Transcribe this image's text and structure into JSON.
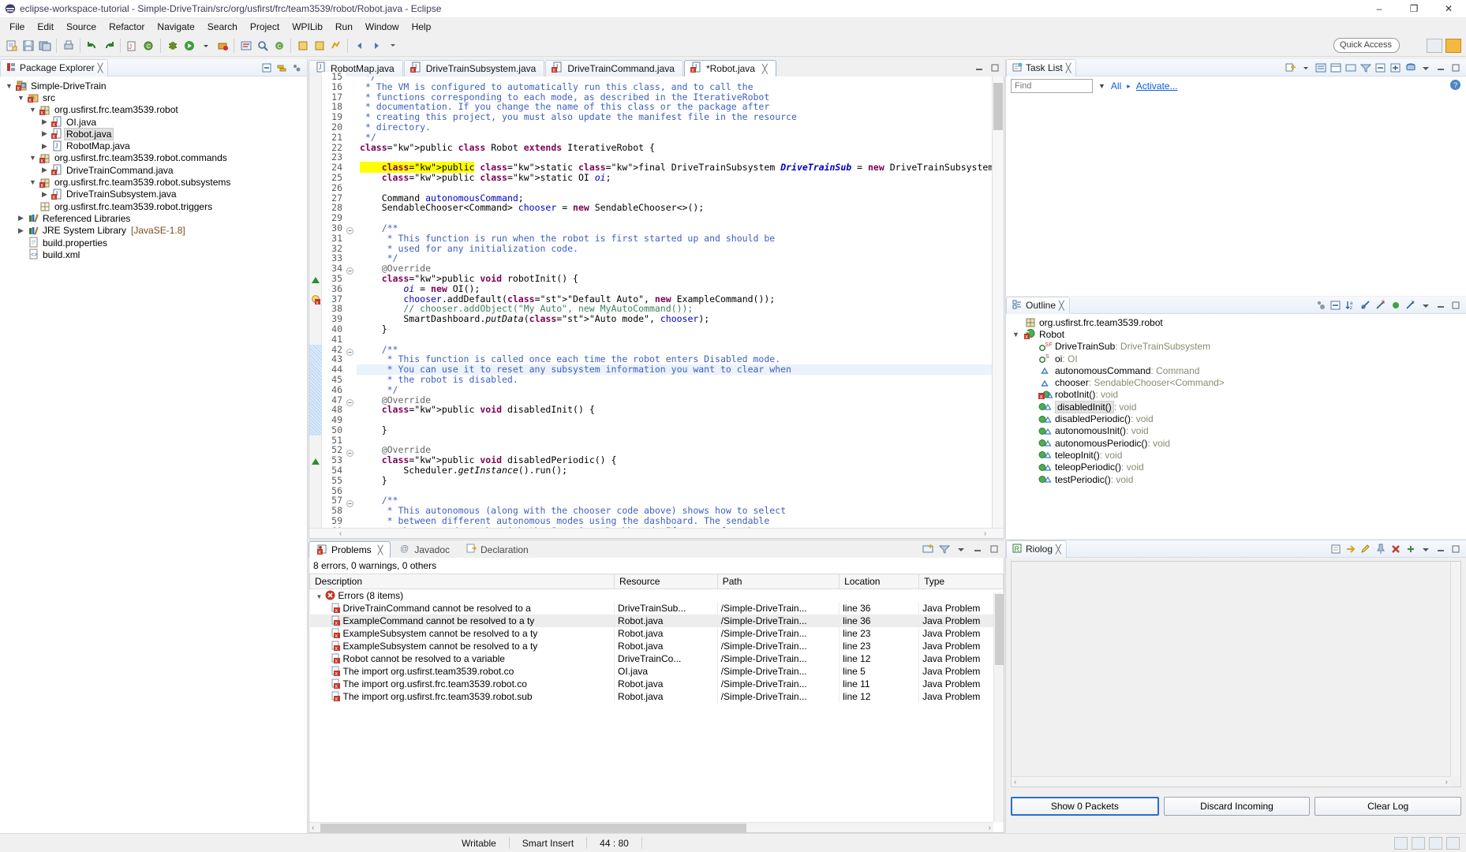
{
  "window": {
    "title": "eclipse-workspace-tutorial - Simple-DriveTrain/src/org/usfirst/frc/team3539/robot/Robot.java - Eclipse",
    "minimize": "–",
    "maximize": "❐",
    "close": "✕"
  },
  "menubar": {
    "items": [
      "File",
      "Edit",
      "Source",
      "Refactor",
      "Navigate",
      "Search",
      "Project",
      "WPILib",
      "Run",
      "Window",
      "Help"
    ]
  },
  "toolbar": {
    "quick_access_placeholder": "Quick Access"
  },
  "package_explorer": {
    "title": "Package Explorer",
    "tree": [
      {
        "label": "Simple-DriveTrain",
        "indent": 0,
        "twisty": "v",
        "icon": "project-error-icon",
        "selected": false
      },
      {
        "label": "src",
        "indent": 1,
        "twisty": "v",
        "icon": "source-folder-error-icon",
        "selected": false
      },
      {
        "label": "org.usfirst.frc.team3539.robot",
        "indent": 2,
        "twisty": "v",
        "icon": "package-error-icon",
        "selected": false
      },
      {
        "label": "OI.java",
        "indent": 3,
        "twisty": ">",
        "icon": "java-file-error-icon",
        "selected": false
      },
      {
        "label": "Robot.java",
        "indent": 3,
        "twisty": ">",
        "icon": "java-file-error-icon",
        "selected": true
      },
      {
        "label": "RobotMap.java",
        "indent": 3,
        "twisty": ">",
        "icon": "java-file-icon",
        "selected": false
      },
      {
        "label": "org.usfirst.frc.team3539.robot.commands",
        "indent": 2,
        "twisty": "v",
        "icon": "package-error-icon",
        "selected": false
      },
      {
        "label": "DriveTrainCommand.java",
        "indent": 3,
        "twisty": ">",
        "icon": "java-file-error-icon",
        "selected": false
      },
      {
        "label": "org.usfirst.frc.team3539.robot.subsystems",
        "indent": 2,
        "twisty": "v",
        "icon": "package-error-icon",
        "selected": false
      },
      {
        "label": "DriveTrainSubsystem.java",
        "indent": 3,
        "twisty": ">",
        "icon": "java-file-error-icon",
        "selected": false
      },
      {
        "label": "org.usfirst.frc.team3539.robot.triggers",
        "indent": 2,
        "twisty": "",
        "icon": "package-empty-icon",
        "selected": false
      },
      {
        "label": "Referenced Libraries",
        "indent": 1,
        "twisty": ">",
        "icon": "library-icon",
        "selected": false
      },
      {
        "label": "JRE System Library",
        "suffix": "[JavaSE-1.8]",
        "indent": 1,
        "twisty": ">",
        "icon": "library-icon",
        "selected": false
      },
      {
        "label": "build.properties",
        "indent": 1,
        "twisty": "",
        "icon": "file-icon",
        "selected": false
      },
      {
        "label": "build.xml",
        "indent": 1,
        "twisty": "",
        "icon": "xml-file-icon",
        "selected": false
      }
    ]
  },
  "editor": {
    "tabs": [
      {
        "label": "RobotMap.java",
        "icon": "java-file-icon",
        "active": false
      },
      {
        "label": "DriveTrainSubsystem.java",
        "icon": "java-file-error-icon",
        "active": false
      },
      {
        "label": "DriveTrainCommand.java",
        "icon": "java-file-error-icon",
        "active": false
      },
      {
        "label": "*Robot.java",
        "icon": "java-file-error-icon",
        "active": true
      }
    ],
    "first_visible_line": 15,
    "lines": [
      {
        "n": 15,
        "text": " */",
        "clipped": true
      },
      {
        "n": 16,
        "text": " * The VM is configured to automatically run this class, and to call the"
      },
      {
        "n": 17,
        "text": " * functions corresponding to each mode, as described in the IterativeRobot"
      },
      {
        "n": 18,
        "text": " * documentation. If you change the name of this class or the package after"
      },
      {
        "n": 19,
        "text": " * creating this project, you must also update the manifest file in the resource"
      },
      {
        "n": 20,
        "text": " * directory."
      },
      {
        "n": 21,
        "text": " */"
      },
      {
        "n": 22,
        "text": "public class Robot extends IterativeRobot {"
      },
      {
        "n": 23,
        "text": ""
      },
      {
        "n": 24,
        "text": "    public static final DriveTrainSubsystem DriveTrainSub = new DriveTrainSubsystem();",
        "highlighted": true
      },
      {
        "n": 25,
        "text": "    public static OI oi;"
      },
      {
        "n": 26,
        "text": ""
      },
      {
        "n": 27,
        "text": "    Command autonomousCommand;"
      },
      {
        "n": 28,
        "text": "    SendableChooser<Command> chooser = new SendableChooser<>();"
      },
      {
        "n": 29,
        "text": ""
      },
      {
        "n": 30,
        "text": "    /**",
        "fold": true
      },
      {
        "n": 31,
        "text": "     * This function is run when the robot is first started up and should be"
      },
      {
        "n": 32,
        "text": "     * used for any initialization code."
      },
      {
        "n": 33,
        "text": "     */"
      },
      {
        "n": 34,
        "text": "    @Override",
        "fold": true
      },
      {
        "n": 35,
        "text": "    public void robotInit() {",
        "marker": "override"
      },
      {
        "n": 36,
        "text": "        oi = new OI();"
      },
      {
        "n": 37,
        "text": "        chooser.addDefault(\"Default Auto\", new ExampleCommand());",
        "marker": "error"
      },
      {
        "n": 38,
        "text": "        // chooser.addObject(\"My Auto\", new MyAutoCommand());"
      },
      {
        "n": 39,
        "text": "        SmartDashboard.putData(\"Auto mode\", chooser);"
      },
      {
        "n": 40,
        "text": "    }"
      },
      {
        "n": 41,
        "text": ""
      },
      {
        "n": 42,
        "text": "    /**",
        "fold": true
      },
      {
        "n": 43,
        "text": "     * This function is called once each time the robot enters Disabled mode."
      },
      {
        "n": 44,
        "text": "     * You can use it to reset any subsystem information you want to clear when",
        "current": true
      },
      {
        "n": 45,
        "text": "     * the robot is disabled."
      },
      {
        "n": 46,
        "text": "     */"
      },
      {
        "n": 47,
        "text": "    @Override",
        "fold": true
      },
      {
        "n": 48,
        "text": "    public void disabledInit() {",
        "marker": "override"
      },
      {
        "n": 49,
        "text": ""
      },
      {
        "n": 50,
        "text": "    }"
      },
      {
        "n": 51,
        "text": ""
      },
      {
        "n": 52,
        "text": "    @Override",
        "fold": true
      },
      {
        "n": 53,
        "text": "    public void disabledPeriodic() {",
        "marker": "override"
      },
      {
        "n": 54,
        "text": "        Scheduler.getInstance().run();"
      },
      {
        "n": 55,
        "text": "    }"
      },
      {
        "n": 56,
        "text": ""
      },
      {
        "n": 57,
        "text": "    /**",
        "fold": true
      },
      {
        "n": 58,
        "text": "     * This autonomous (along with the chooser code above) shows how to select"
      },
      {
        "n": 59,
        "text": "     * between different autonomous modes using the dashboard. The sendable"
      },
      {
        "n": 60,
        "text": "     * chooser code works with the Java SmartDashboard. If you prefer the"
      }
    ]
  },
  "task_list": {
    "title": "Task List",
    "find_placeholder": "Find",
    "all_label": "All",
    "activate_label": "Activate..."
  },
  "outline": {
    "title": "Outline",
    "items": [
      {
        "name": "org.usfirst.frc.team3539.robot",
        "type": "",
        "icon": "package-icon",
        "indent": 0,
        "twisty": "",
        "selected": false
      },
      {
        "name": "Robot",
        "type": "",
        "icon": "class-error-icon",
        "indent": 0,
        "twisty": "v",
        "selected": false
      },
      {
        "name": "DriveTrainSub",
        "type": " : DriveTrainSubsystem",
        "icon": "field-static-final-icon",
        "indent": 1,
        "twisty": "",
        "selected": false
      },
      {
        "name": "oi",
        "type": " : OI",
        "icon": "field-static-icon",
        "indent": 1,
        "twisty": "",
        "selected": false
      },
      {
        "name": "autonomousCommand",
        "type": " : Command",
        "icon": "field-default-icon",
        "indent": 1,
        "twisty": "",
        "selected": false
      },
      {
        "name": "chooser",
        "type": " : SendableChooser<Command>",
        "icon": "field-default-icon",
        "indent": 1,
        "twisty": "",
        "selected": false
      },
      {
        "name": "robotInit()",
        "type": " : void",
        "icon": "method-error-icon",
        "indent": 1,
        "twisty": "",
        "selected": false
      },
      {
        "name": "disabledInit()",
        "type": " : void",
        "icon": "method-icon",
        "indent": 1,
        "twisty": "",
        "selected": true
      },
      {
        "name": "disabledPeriodic()",
        "type": " : void",
        "icon": "method-icon",
        "indent": 1,
        "twisty": "",
        "selected": false
      },
      {
        "name": "autonomousInit()",
        "type": " : void",
        "icon": "method-icon",
        "indent": 1,
        "twisty": "",
        "selected": false
      },
      {
        "name": "autonomousPeriodic()",
        "type": " : void",
        "icon": "method-icon",
        "indent": 1,
        "twisty": "",
        "selected": false
      },
      {
        "name": "teleopInit()",
        "type": " : void",
        "icon": "method-icon",
        "indent": 1,
        "twisty": "",
        "selected": false
      },
      {
        "name": "teleopPeriodic()",
        "type": " : void",
        "icon": "method-icon",
        "indent": 1,
        "twisty": "",
        "selected": false
      },
      {
        "name": "testPeriodic()",
        "type": " : void",
        "icon": "method-icon",
        "indent": 1,
        "twisty": "",
        "selected": false
      }
    ]
  },
  "problems": {
    "tabs": [
      {
        "label": "Problems",
        "icon": "problems-icon",
        "active": true
      },
      {
        "label": "Javadoc",
        "icon": "javadoc-icon",
        "active": false
      },
      {
        "label": "Declaration",
        "icon": "declaration-icon",
        "active": false
      }
    ],
    "summary": "8 errors, 0 warnings, 0 others",
    "columns": [
      "Description",
      "Resource",
      "Path",
      "Location",
      "Type"
    ],
    "group_label": "Errors (8 items)",
    "rows": [
      {
        "description": "DriveTrainCommand cannot be resolved to a",
        "resource": "DriveTrainSub...",
        "path": "/Simple-DriveTrain...",
        "location": "line 36",
        "type": "Java Problem"
      },
      {
        "description": "ExampleCommand cannot be resolved to a ty",
        "resource": "Robot.java",
        "path": "/Simple-DriveTrain...",
        "location": "line 36",
        "type": "Java Problem"
      },
      {
        "description": "ExampleSubsystem cannot be resolved to a ty",
        "resource": "Robot.java",
        "path": "/Simple-DriveTrain...",
        "location": "line 23",
        "type": "Java Problem"
      },
      {
        "description": "ExampleSubsystem cannot be resolved to a ty",
        "resource": "Robot.java",
        "path": "/Simple-DriveTrain...",
        "location": "line 23",
        "type": "Java Problem"
      },
      {
        "description": "Robot cannot be resolved to a variable",
        "resource": "DriveTrainCo...",
        "path": "/Simple-DriveTrain...",
        "location": "line 12",
        "type": "Java Problem"
      },
      {
        "description": "The import org.usfirst.team3539.robot.co",
        "resource": "OI.java",
        "path": "/Simple-DriveTrain...",
        "location": "line 5",
        "type": "Java Problem"
      },
      {
        "description": "The import org.usfirst.frc.team3539.robot.co",
        "resource": "Robot.java",
        "path": "/Simple-DriveTrain...",
        "location": "line 11",
        "type": "Java Problem"
      },
      {
        "description": "The import org.usfirst.frc.team3539.robot.sub",
        "resource": "Robot.java",
        "path": "/Simple-DriveTrain...",
        "location": "line 12",
        "type": "Java Problem"
      }
    ]
  },
  "riolog": {
    "title": "Riolog",
    "buttons": [
      {
        "label": "Show 0 Packets",
        "primary": true
      },
      {
        "label": "Discard Incoming",
        "primary": false
      },
      {
        "label": "Clear Log",
        "primary": false
      }
    ]
  },
  "statusbar": {
    "writable": "Writable",
    "insert_mode": "Smart Insert",
    "position": "44 : 80"
  }
}
